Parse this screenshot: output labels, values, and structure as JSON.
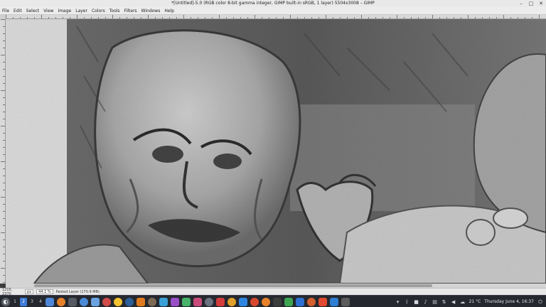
{
  "window": {
    "title": "*[Untitled]-5.0 (RGB color 8-bit gamma integer, GIMP built-in sRGB, 1 layer) 5504x3008 – GIMP",
    "controls": [
      "minimize-icon",
      "maximize-icon",
      "close-icon"
    ]
  },
  "menu": [
    {
      "label": "File"
    },
    {
      "label": "Edit"
    },
    {
      "label": "Select"
    },
    {
      "label": "View"
    },
    {
      "label": "Image"
    },
    {
      "label": "Layer"
    },
    {
      "label": "Colors"
    },
    {
      "label": "Tools"
    },
    {
      "label": "Filters"
    },
    {
      "label": "Windows"
    },
    {
      "label": "Help"
    }
  ],
  "statusbar": {
    "coords": "1215, 2370",
    "unit": "px",
    "zoom": "44.1 %",
    "message": "Pasted Layer (170.9 MB)"
  },
  "taskbar": {
    "workspaces": [
      "1",
      "2",
      "3",
      "4"
    ],
    "active_workspace": "2",
    "apps": [
      {
        "name": "folder-icon",
        "color": "#4e86d8",
        "round": false
      },
      {
        "name": "firefox-icon",
        "color": "#e8822a",
        "round": true
      },
      {
        "name": "terminal-icon",
        "color": "#555a63",
        "round": false
      },
      {
        "name": "chrome-icon",
        "color": "#4b8bd6",
        "round": true
      },
      {
        "name": "files-icon",
        "color": "#6aa3e0",
        "round": false
      },
      {
        "name": "mail-icon",
        "color": "#d34b4b",
        "round": true
      },
      {
        "name": "notes-icon",
        "color": "#f2c230",
        "round": true
      },
      {
        "name": "steam-icon",
        "color": "#2d5f9a",
        "round": true
      },
      {
        "name": "vlc-icon",
        "color": "#e07a1f",
        "round": false
      },
      {
        "name": "gimp-icon",
        "color": "#7d6a55",
        "round": true
      },
      {
        "name": "editor-icon",
        "color": "#3aa0d8",
        "round": false
      },
      {
        "name": "krita-icon",
        "color": "#9a4fc8",
        "round": false
      },
      {
        "name": "image-viewer-icon",
        "color": "#47b36b",
        "round": false
      },
      {
        "name": "calendar-icon",
        "color": "#c94b7a",
        "round": false
      },
      {
        "name": "settings-icon",
        "color": "#6b7280",
        "round": true
      },
      {
        "name": "video-icon",
        "color": "#d33c3c",
        "round": false
      },
      {
        "name": "photos-icon",
        "color": "#e0a02a",
        "round": true
      },
      {
        "name": "dropbox-icon",
        "color": "#2f86e0",
        "round": false
      },
      {
        "name": "music-icon",
        "color": "#d9472f",
        "round": true
      },
      {
        "name": "blender-icon",
        "color": "#e8822a",
        "round": true
      },
      {
        "name": "inkscape-icon",
        "color": "#3d3d3d",
        "round": false
      },
      {
        "name": "calc-icon",
        "color": "#3ea652",
        "round": false
      },
      {
        "name": "writer-icon",
        "color": "#2e6fd1",
        "round": false
      },
      {
        "name": "chat-icon",
        "color": "#d45f2f",
        "round": true
      },
      {
        "name": "xmind-icon",
        "color": "#e2492f",
        "round": false
      },
      {
        "name": "vscode-icon",
        "color": "#2f7fd4",
        "round": false
      },
      {
        "name": "gimp-window-icon",
        "color": "#5c5c5c",
        "round": false
      }
    ],
    "tray": {
      "weather": "21 °C",
      "datetime": "Thursday June 4, 16:37"
    }
  }
}
